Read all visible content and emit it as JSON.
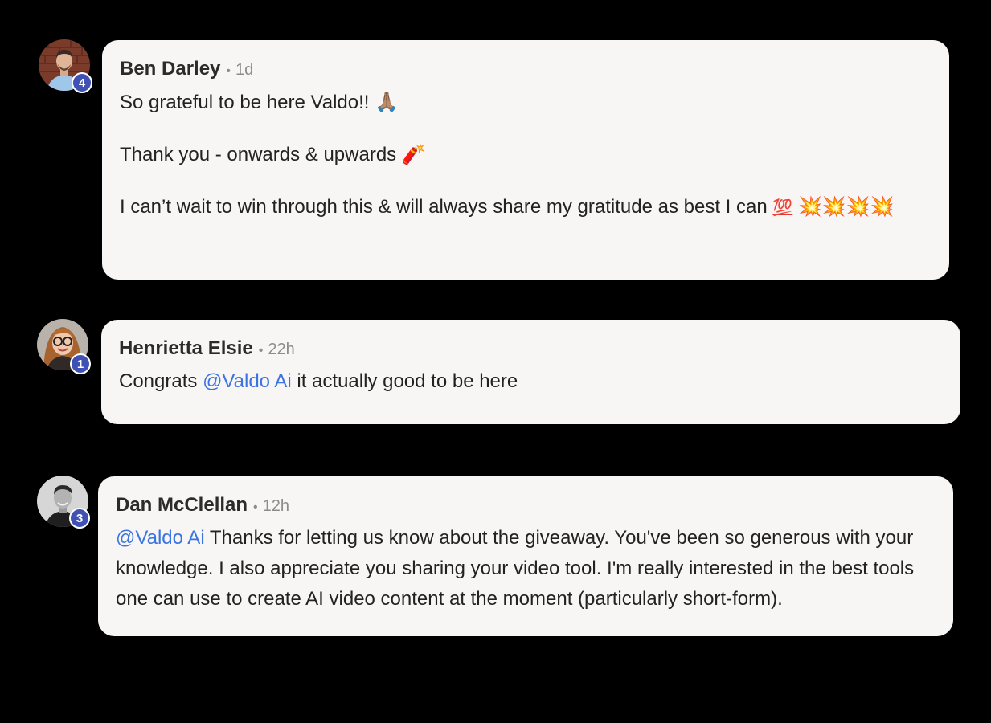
{
  "comments": [
    {
      "author": "Ben Darley",
      "separator": "•",
      "time": "1d",
      "level": "4",
      "paragraphs": [
        {
          "text": "So grateful to be here Valdo!! ",
          "emoji": "🙏🏽"
        },
        {
          "text": "Thank you - onwards & upwards ",
          "emoji": "🧨"
        },
        {
          "text": "I can’t wait to win through this & will always share my gratitude as best I can ",
          "emoji_100": "💯",
          "emoji_boom": "💥💥💥💥"
        }
      ]
    },
    {
      "author": "Henrietta Elsie",
      "separator": "•",
      "time": "22h",
      "level": "1",
      "prefix": "Congrats ",
      "mention": "@Valdo Ai",
      "suffix": " it actually good to be here"
    },
    {
      "author": "Dan McClellan",
      "separator": "•",
      "time": "12h",
      "level": "3",
      "mention": "@Valdo Ai",
      "text": " Thanks for letting us know about the giveaway. You've been so generous with your knowledge. I also appreciate you sharing your video tool. I'm really interested in the best tools one can use to create AI video content at the moment (particularly short-form)."
    }
  ],
  "colors": {
    "background": "#000000",
    "bubble": "#f7f6f4",
    "mention": "#3b74e0",
    "badge": "#3f51b5"
  },
  "icons": {
    "avatar_1": "avatar-photo-man-brick-wall",
    "avatar_2": "avatar-photo-woman-glasses",
    "avatar_3": "avatar-photo-man-bw"
  }
}
